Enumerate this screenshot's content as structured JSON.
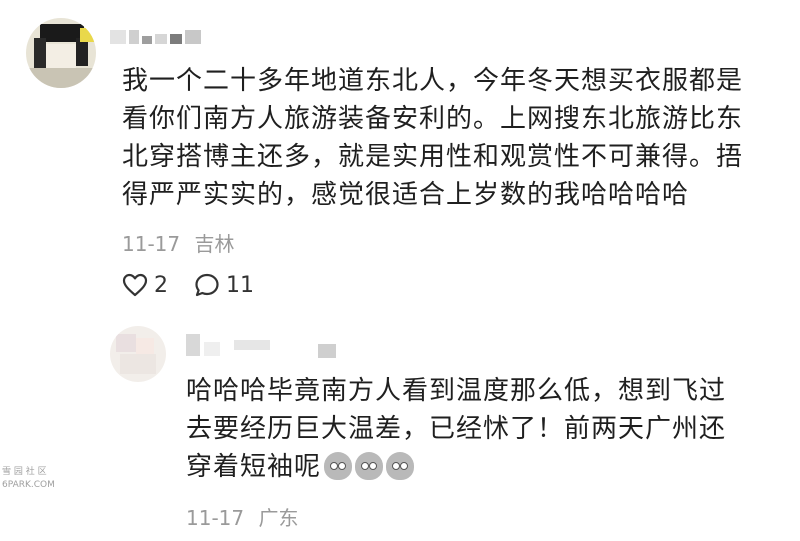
{
  "comment": {
    "text": "我一个二十多年地道东北人，今年冬天想买衣服都是看你们南方人旅游装备安利的。上网搜东北旅游比东北穿搭博主还多，就是实用性和观赏性不可兼得。捂得严严实实的，感觉很适合上岁数的我哈哈哈哈",
    "date": "11-17",
    "location": "吉林",
    "like_count": "2",
    "reply_count": "11"
  },
  "reply": {
    "text": "哈哈哈毕竟南方人看到温度那么低，想到飞过去要经历巨大温差，已经怵了！前两天广州还穿着短袖呢",
    "emoji_count": 3,
    "date": "11-17",
    "location": "广东"
  },
  "watermark": {
    "line1": "雪 园 社 区",
    "line2": "6PARK.COM"
  },
  "icons": {
    "like": "heart-outline-icon",
    "reply": "speech-bubble-icon",
    "emoji": "sweat-face-emoji-icon"
  }
}
